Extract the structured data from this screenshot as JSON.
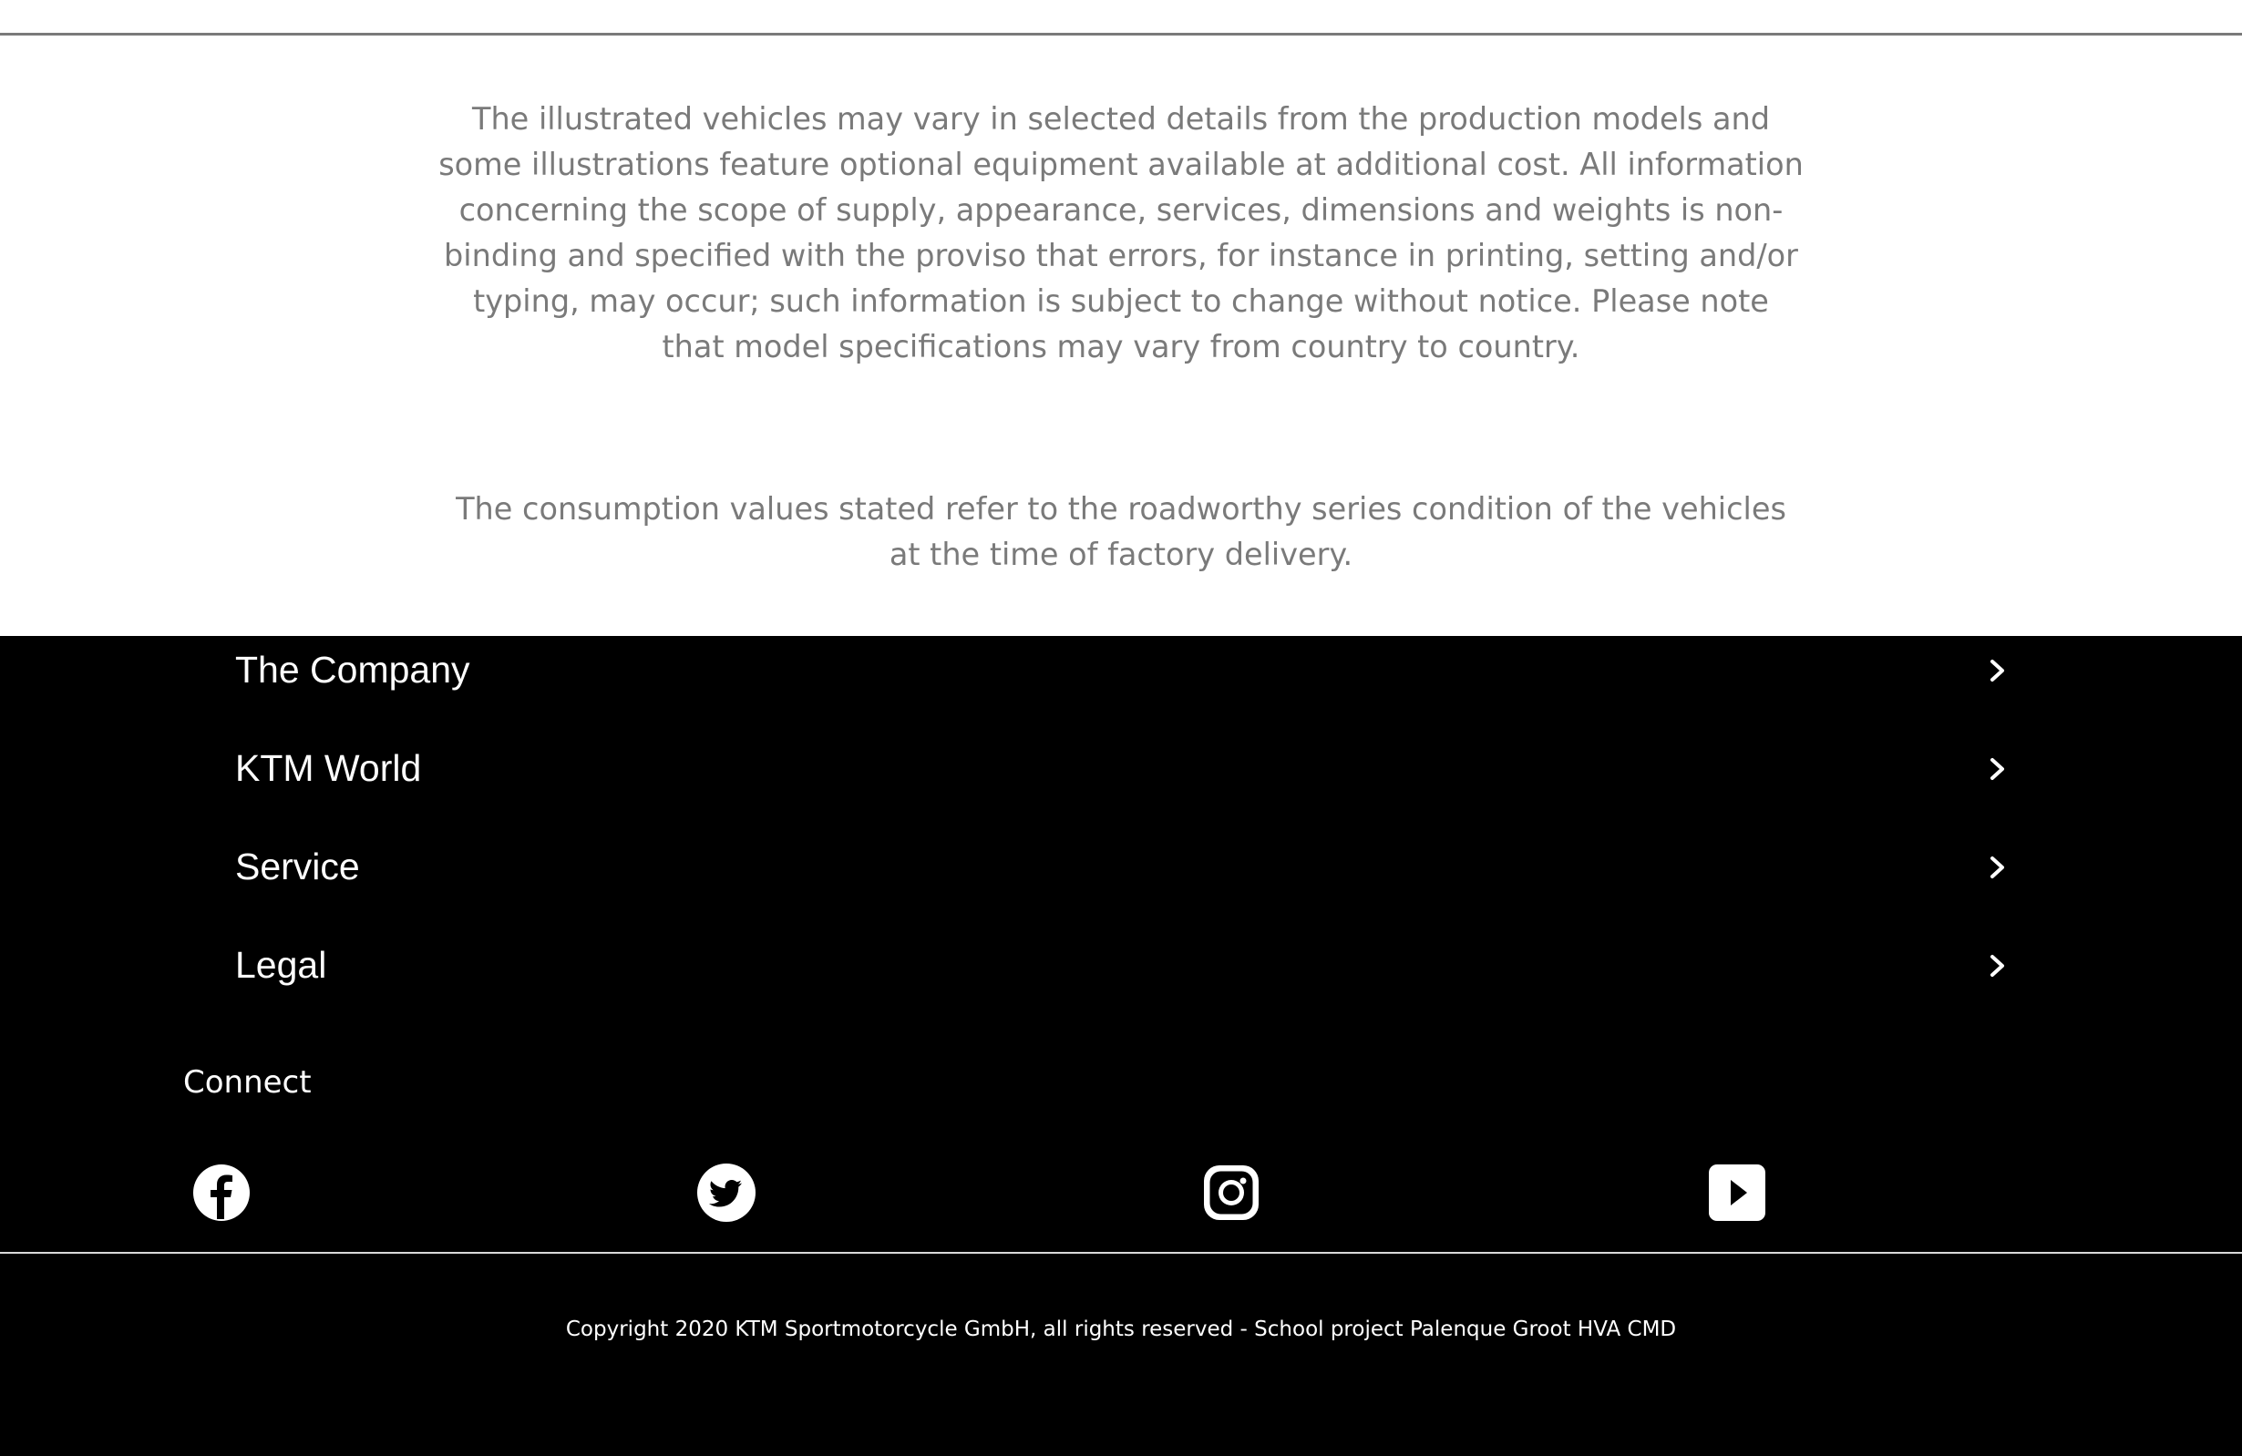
{
  "disclaimers": {
    "vehicles_text": "The illustrated vehicles may vary in selected details from the production models and some illustrations feature optional equipment available at additional cost. All information concerning the scope of supply, appearance, services, dimensions and weights is non-binding and specified with the proviso that errors, for instance in printing, setting and/or typing, may occur; such information is subject to change without notice. Please note that model specifications may vary from country to country.",
    "consumption_text": "The consumption values stated refer to the roadworthy series condition of the vehicles at the time of factory delivery."
  },
  "footer": {
    "nav_items": [
      {
        "label": "The Company",
        "icon": "chevron-right-icon"
      },
      {
        "label": "KTM World",
        "icon": "chevron-right-icon"
      },
      {
        "label": "Service",
        "icon": "chevron-right-icon"
      },
      {
        "label": "Legal",
        "icon": "chevron-right-icon"
      }
    ],
    "connect_heading": "Connect",
    "social_icons": [
      "facebook-icon",
      "twitter-icon",
      "instagram-icon",
      "youtube-icon"
    ],
    "copyright": "Copyright 2020 KTM Sportmotorcycle GmbH, all rights reserved - School project Palenque Groot HVA CMD"
  },
  "colors": {
    "page_background": "#ffffff",
    "footer_background": "#000000",
    "disclaimer_text": "#7a7a7a",
    "footer_text": "#ffffff"
  }
}
